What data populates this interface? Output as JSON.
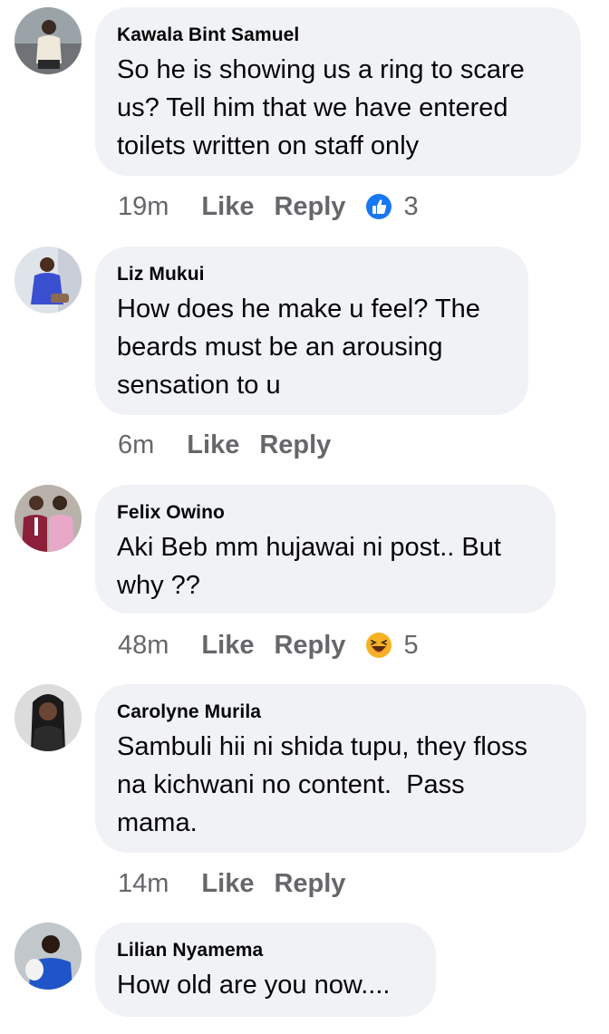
{
  "comments": [
    {
      "author": "Kawala Bint Samuel",
      "text": "So he is showing us a ring to scare\nus? Tell him that we have entered\ntoilets written on staff only",
      "time": "19m",
      "like_label": "Like",
      "reply_label": "Reply",
      "reaction": {
        "icon": "thumbs-up-icon",
        "count": "3"
      }
    },
    {
      "author": "Liz Mukui",
      "text": "How does he make u feel? The\nbeards must be an arousing\nsensation to u",
      "time": "6m",
      "like_label": "Like",
      "reply_label": "Reply"
    },
    {
      "author": "Felix Owino",
      "text": "Aki Beb mm hujawai ni post.. But\nwhy ??",
      "time": "48m",
      "like_label": "Like",
      "reply_label": "Reply",
      "reaction": {
        "icon": "haha-icon",
        "count": "5"
      }
    },
    {
      "author": "Carolyne Murila",
      "text": "Sambuli hii ni shida tupu, they floss\nna kichwani no content.  Pass\nmama.",
      "time": "14m",
      "like_label": "Like",
      "reply_label": "Reply"
    },
    {
      "author": "Lilian Nyamema",
      "text": "How old are you now....",
      "time": "",
      "like_label": "",
      "reply_label": ""
    }
  ],
  "colors": {
    "bubble": "#f0f2f5",
    "meta_text": "#65676b",
    "like_blue": "#1877f2",
    "haha_yellow": "#f7b125"
  }
}
